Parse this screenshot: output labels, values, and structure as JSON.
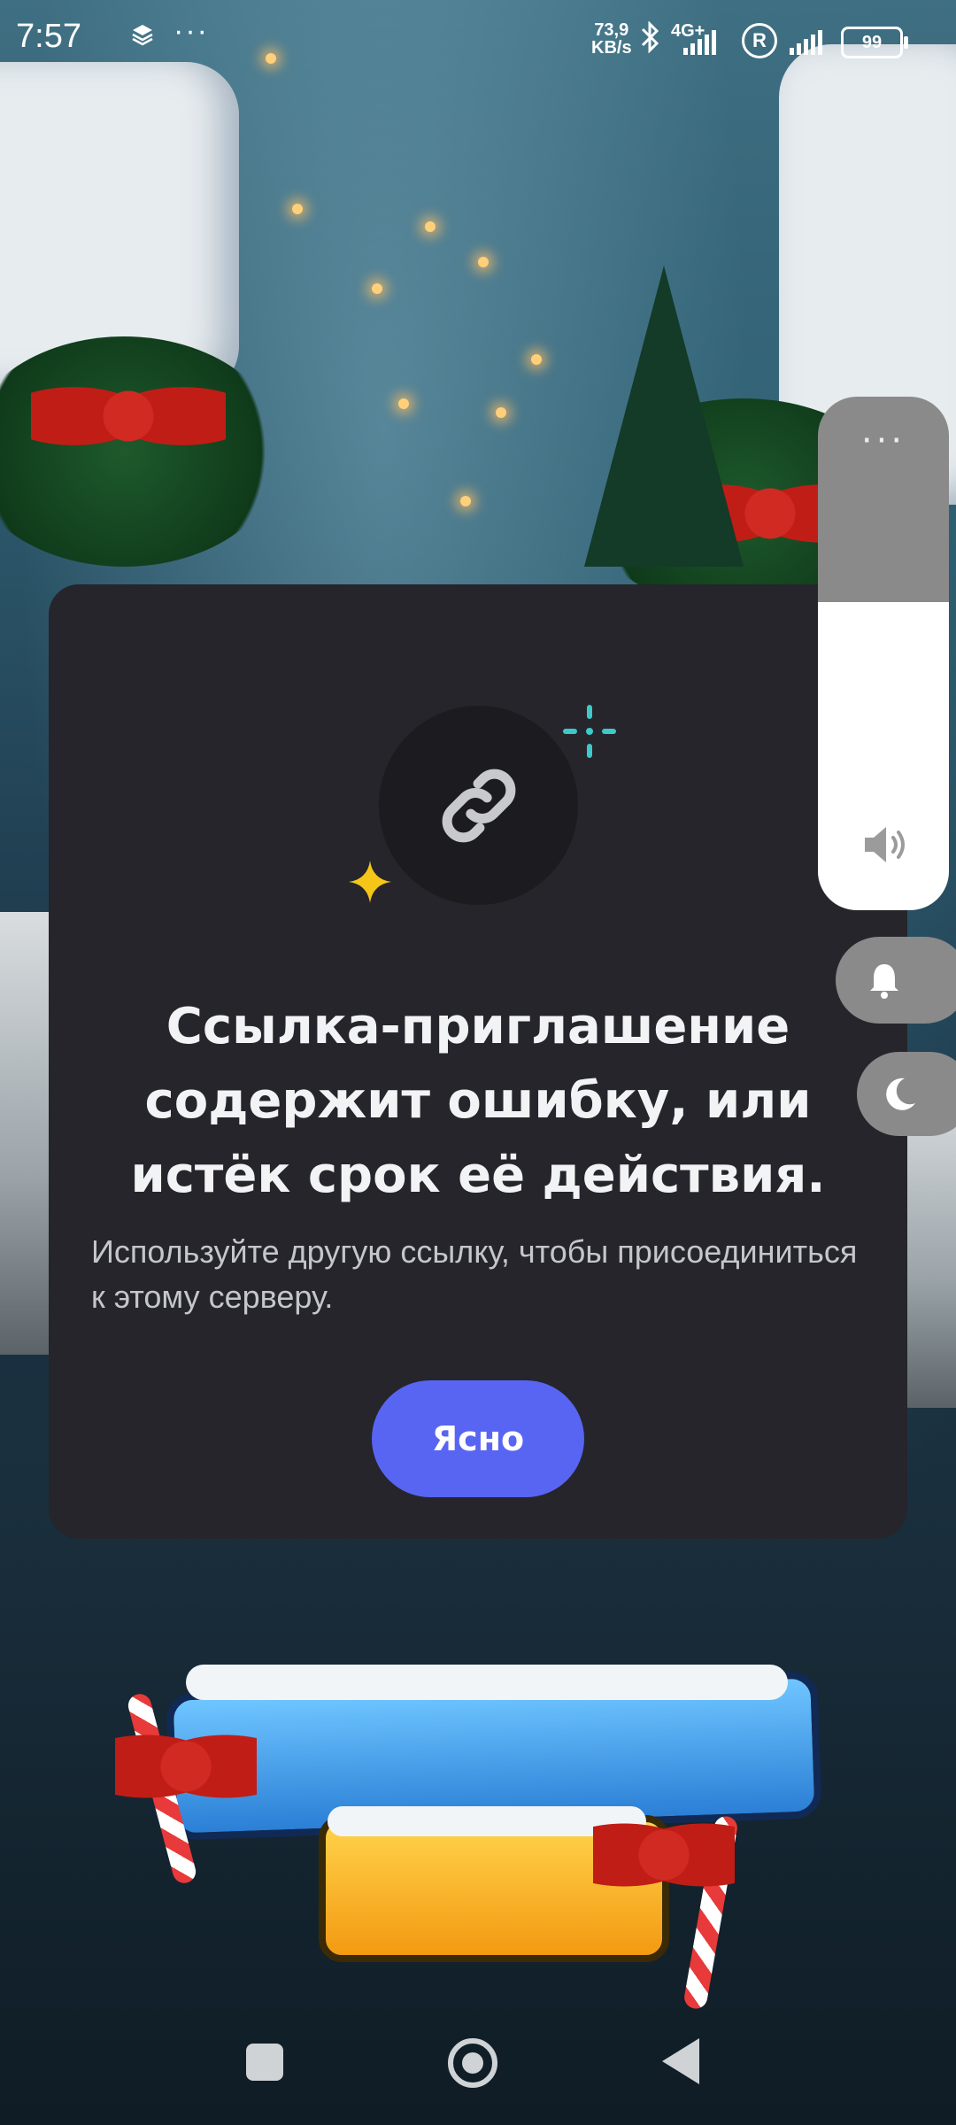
{
  "status_bar": {
    "time": "7:57",
    "stack_icon": "layers-icon",
    "more": "···",
    "speed_value": "73,9",
    "speed_unit": "KB/s",
    "network": "4G+",
    "roaming": "R",
    "battery": "99"
  },
  "dialog": {
    "icon": "link-icon",
    "title": "Ссылка-приглашение содержит ошибку, или истёк срок её действия.",
    "subtitle": "Используйте другую ссылку, чтобы присоединиться к этому серверу.",
    "button_label": "Ясно",
    "accent_color": "#5865f2"
  },
  "volume_overlay": {
    "more": "···",
    "level_fraction": 0.6,
    "speaker_icon": "speaker-icon",
    "ring_icon": "bell-icon",
    "dnd_icon": "moon-icon"
  },
  "nav_bar": {
    "recents_icon": "square-icon",
    "home_icon": "circle-icon",
    "back_icon": "triangle-back-icon"
  }
}
